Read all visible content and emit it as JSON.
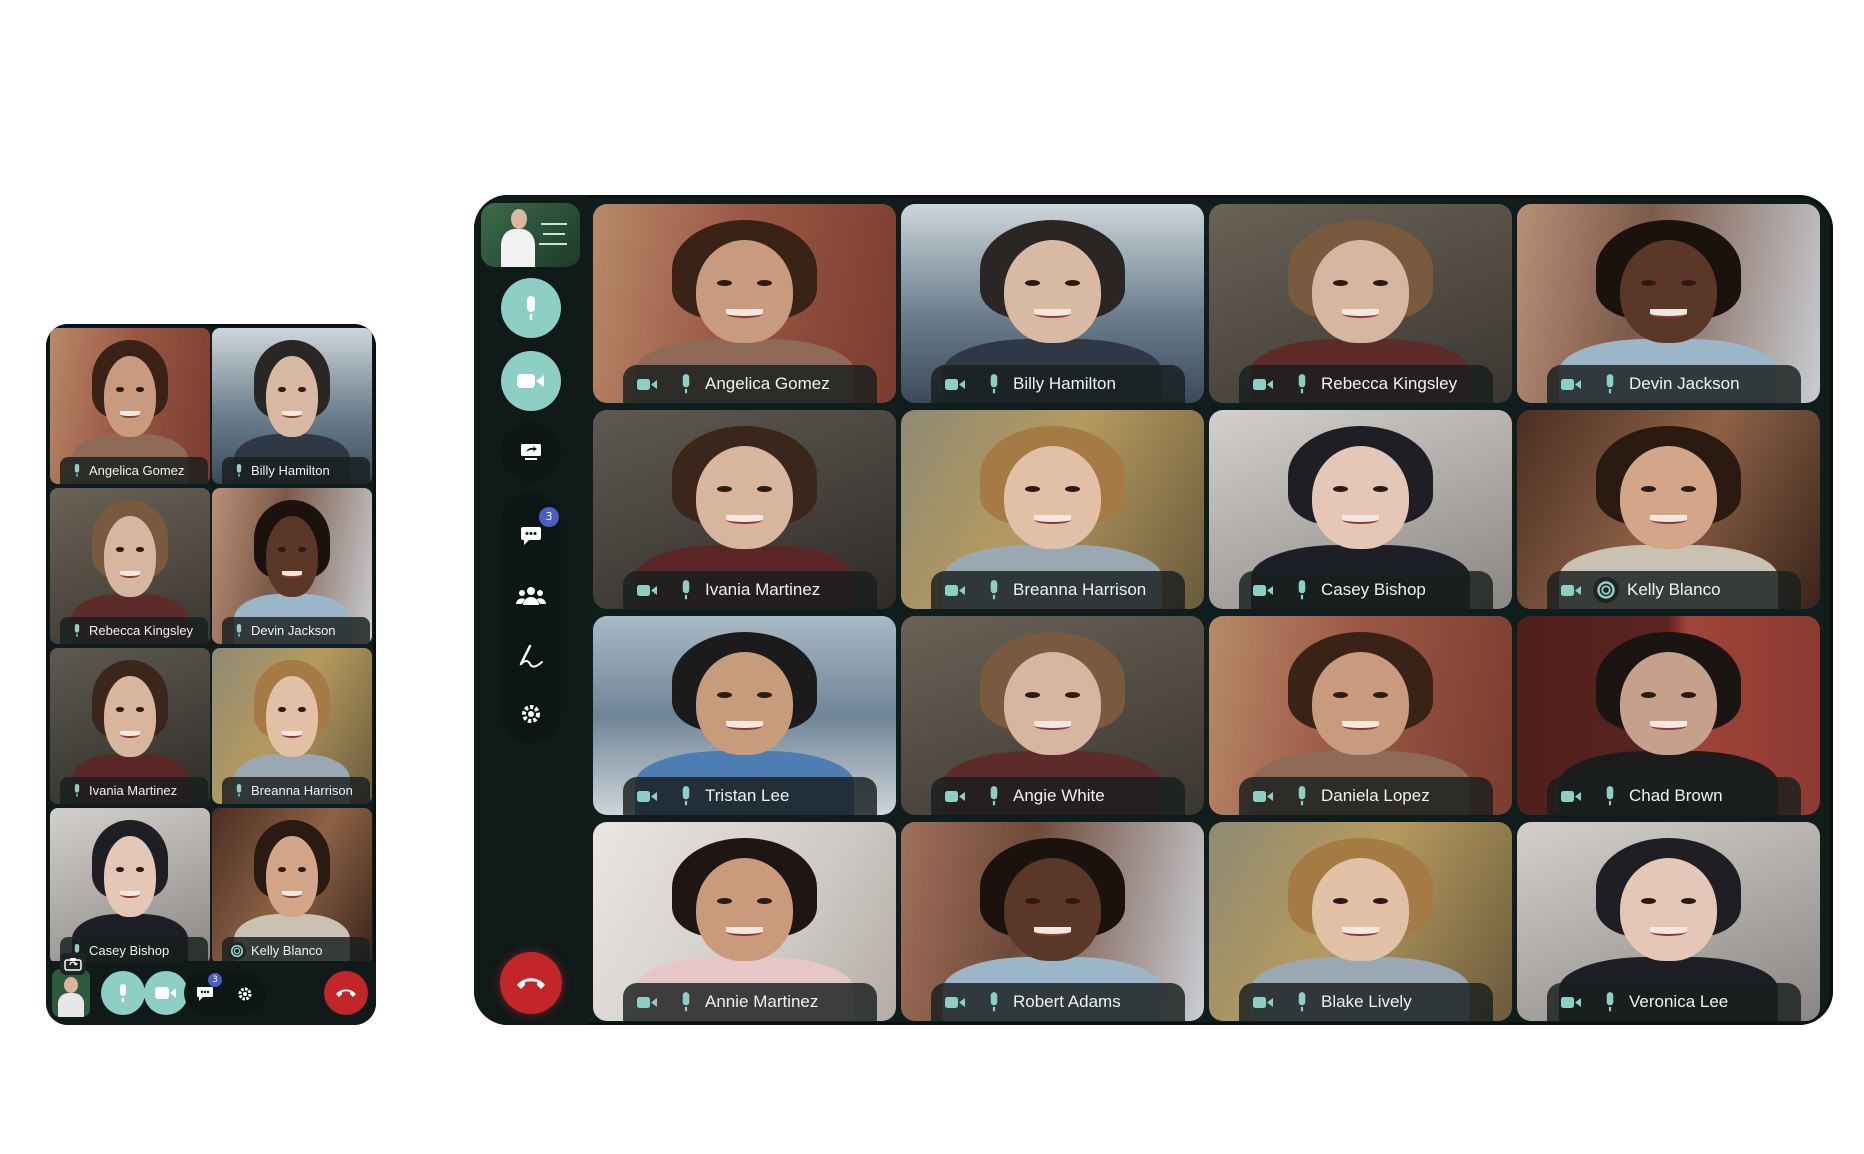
{
  "colors": {
    "accent": "#8ecfc5",
    "hangup": "#c2262a",
    "badge": "#4a5fc1",
    "frame": "#111d1c"
  },
  "toolbar": {
    "chat_badge": "3",
    "icons": [
      "mic-icon",
      "camera-icon",
      "screen-share-icon",
      "chat-icon",
      "participants-icon",
      "whiteboard-icon",
      "settings-icon",
      "hang-up-icon"
    ]
  },
  "desktop": {
    "participants": [
      {
        "name": "Angelica Gomez",
        "status": "mic"
      },
      {
        "name": "Billy Hamilton",
        "status": "mic"
      },
      {
        "name": "Rebecca Kingsley",
        "status": "mic"
      },
      {
        "name": "Devin Jackson",
        "status": "mic"
      },
      {
        "name": "Ivania Martinez",
        "status": "mic"
      },
      {
        "name": "Breanna Harrison",
        "status": "mic"
      },
      {
        "name": "Casey Bishop",
        "status": "mic"
      },
      {
        "name": "Kelly Blanco",
        "status": "speaking"
      },
      {
        "name": "Tristan Lee",
        "status": "mic"
      },
      {
        "name": "Angie White",
        "status": "mic"
      },
      {
        "name": "Daniela Lopez",
        "status": "mic"
      },
      {
        "name": "Chad Brown",
        "status": "mic"
      },
      {
        "name": "Annie Martinez",
        "status": "mic"
      },
      {
        "name": "Robert Adams",
        "status": "mic"
      },
      {
        "name": "Blake Lively",
        "status": "mic"
      },
      {
        "name": "Veronica Lee",
        "status": "mic"
      }
    ]
  },
  "mobile": {
    "participants": [
      {
        "name": "Angelica Gomez",
        "status": "mic"
      },
      {
        "name": "Billy Hamilton",
        "status": "mic"
      },
      {
        "name": "Rebecca Kingsley",
        "status": "mic"
      },
      {
        "name": "Devin Jackson",
        "status": "mic"
      },
      {
        "name": "Ivania Martinez",
        "status": "mic"
      },
      {
        "name": "Breanna Harrison",
        "status": "mic"
      },
      {
        "name": "Casey Bishop",
        "status": "mic"
      },
      {
        "name": "Kelly Blanco",
        "status": "speaking"
      }
    ],
    "chat_badge": "3"
  }
}
